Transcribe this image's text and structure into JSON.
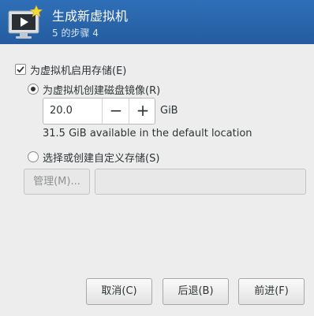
{
  "header": {
    "title": "生成新虚拟机",
    "step": "5 的步骤 4"
  },
  "storage": {
    "enable_label": "为虚拟机启用存储(E)",
    "enabled": true,
    "create_image_label": "为虚拟机创建磁盘镜像(R)",
    "create_image_selected": true,
    "size_value": "20.0",
    "size_unit": "GiB",
    "decrement_symbol": "−",
    "increment_symbol": "+",
    "available_note": "31.5 GiB available in the default location",
    "custom_label": "选择或创建自定义存储(S)",
    "custom_selected": false,
    "manage_label": "管理(M)...",
    "custom_path_value": ""
  },
  "buttons": {
    "cancel": "取消(C)",
    "back": "后退(B)",
    "forward": "前进(F)"
  },
  "colors": {
    "header_bg": "#2a66ab",
    "window_bg": "#ededed"
  }
}
